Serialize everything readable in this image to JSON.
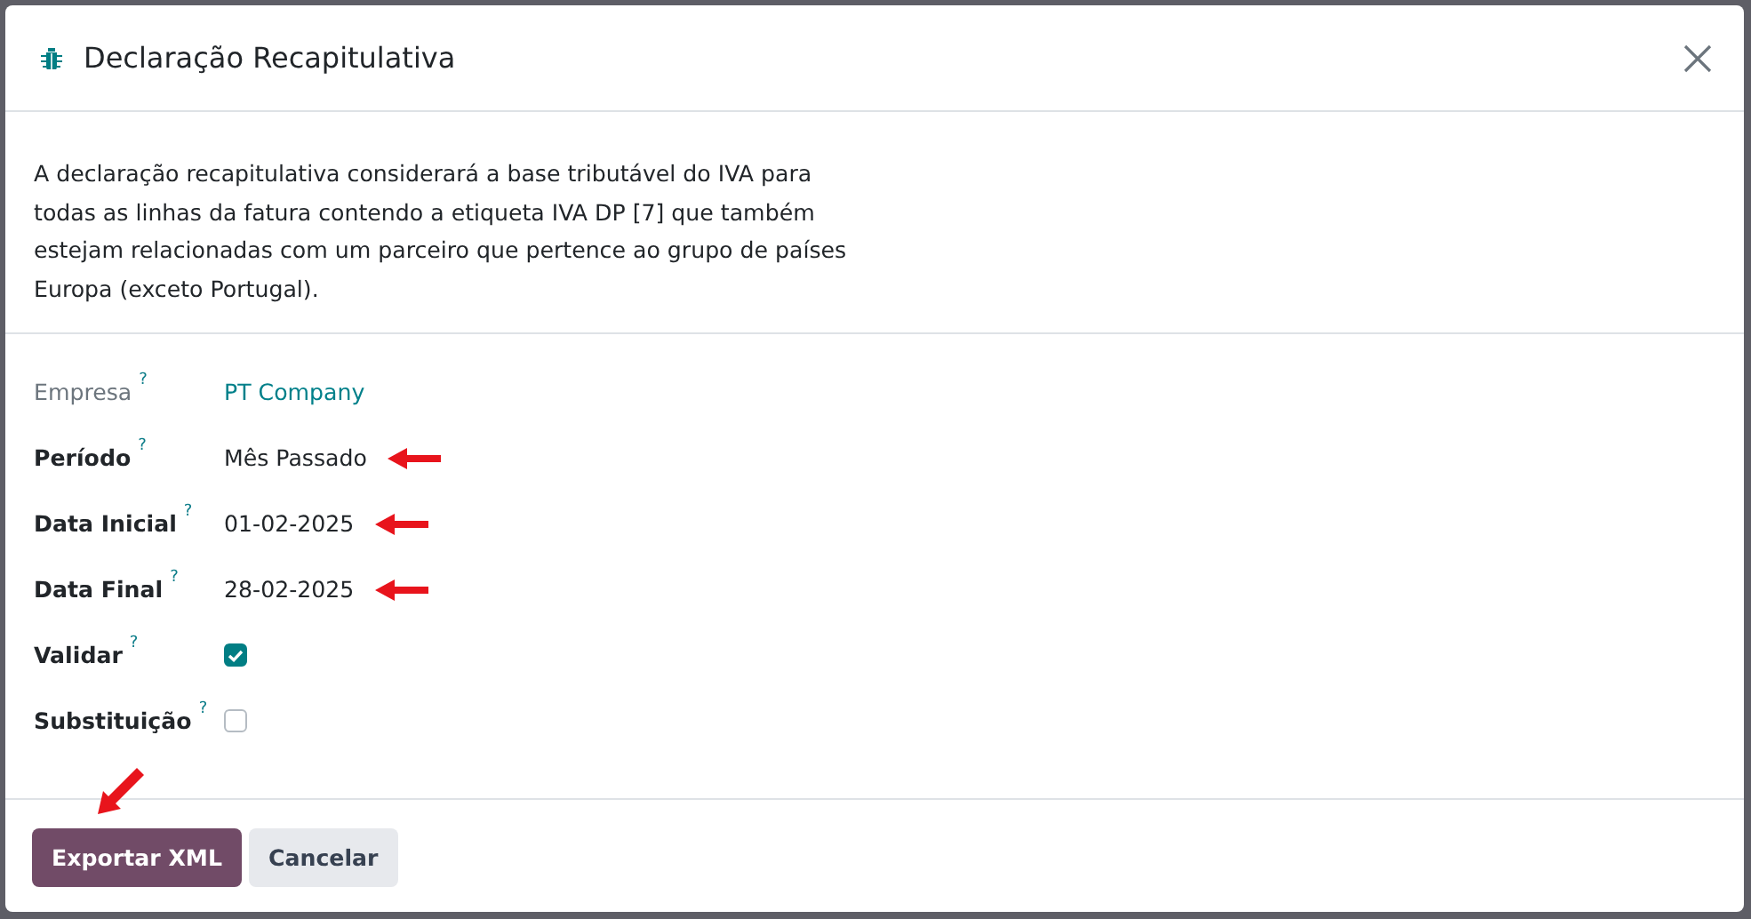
{
  "dialog": {
    "title": "Declaração Recapitulativa",
    "description": "A declaração recapitulativa considerará a base tributável do IVA para todas as linhas da fatura contendo a etiqueta IVA DP [7] que também estejam relacionadas com um parceiro que pertence ao grupo de países Europa (exceto Portugal)."
  },
  "fields": [
    {
      "label": "Empresa",
      "help": "?",
      "kind": "link",
      "readonly": true,
      "value": "PT Company",
      "arrow": false
    },
    {
      "label": "Período",
      "help": "?",
      "kind": "text",
      "readonly": false,
      "value": "Mês Passado",
      "arrow": true
    },
    {
      "label": "Data Inicial",
      "help": "?",
      "kind": "text",
      "readonly": false,
      "value": "01-02-2025",
      "arrow": true
    },
    {
      "label": "Data Final",
      "help": "?",
      "kind": "text",
      "readonly": false,
      "value": "28-02-2025",
      "arrow": true
    },
    {
      "label": "Validar",
      "help": "?",
      "kind": "checkbox",
      "readonly": false,
      "checked": true,
      "arrow": false
    },
    {
      "label": "Substituição",
      "help": "?",
      "kind": "checkbox",
      "readonly": false,
      "checked": false,
      "arrow": false
    }
  ],
  "buttons": [
    {
      "label": "Exportar XML",
      "kind": "primary",
      "arrow": true
    },
    {
      "label": "Cancelar",
      "kind": "secondary",
      "arrow": false
    }
  ]
}
